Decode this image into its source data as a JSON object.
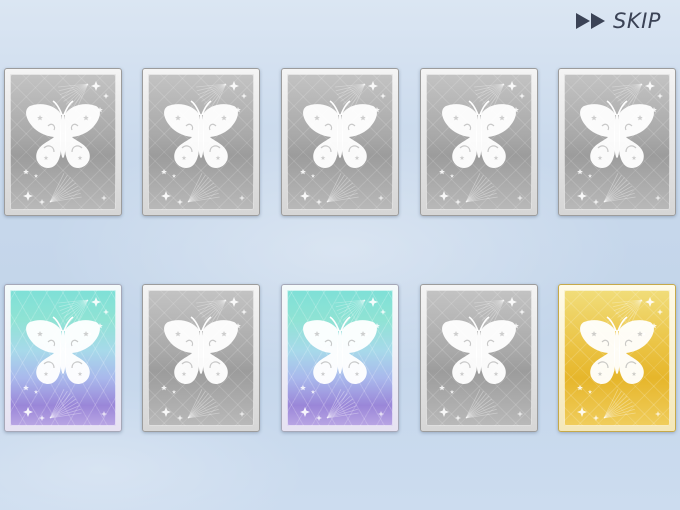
{
  "skip": {
    "label": "SKIP",
    "icon": "fast-forward-icon"
  },
  "cards": [
    {
      "rarity": "silver",
      "icon": "butterfly-icon"
    },
    {
      "rarity": "silver",
      "icon": "butterfly-icon"
    },
    {
      "rarity": "silver",
      "icon": "butterfly-icon"
    },
    {
      "rarity": "silver",
      "icon": "butterfly-icon"
    },
    {
      "rarity": "silver",
      "icon": "butterfly-icon"
    },
    {
      "rarity": "rainbow",
      "icon": "butterfly-icon"
    },
    {
      "rarity": "silver",
      "icon": "butterfly-icon"
    },
    {
      "rarity": "rainbow",
      "icon": "butterfly-icon"
    },
    {
      "rarity": "silver",
      "icon": "butterfly-icon"
    },
    {
      "rarity": "gold",
      "icon": "butterfly-icon"
    }
  ],
  "colors": {
    "background": "#c9d9ec",
    "silver": "#a9a9a9",
    "rainbow": [
      "#7ee0d7",
      "#a7d9ea",
      "#9a86d8"
    ],
    "gold": "#ebc445",
    "skip_text": "#3b4356"
  }
}
